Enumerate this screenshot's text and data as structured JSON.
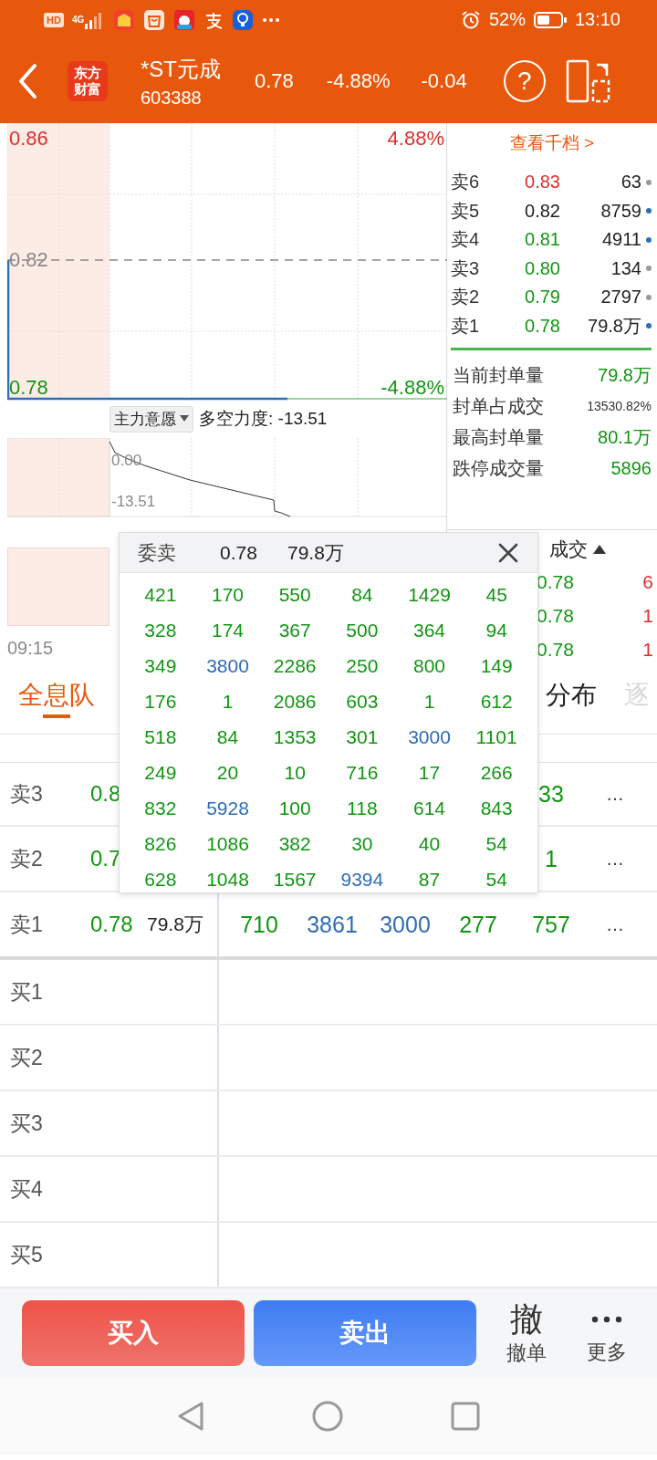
{
  "status_bar": {
    "hd": "HD",
    "network": "4G",
    "battery": "52%",
    "time": "13:10"
  },
  "header": {
    "logo_text": "东方财富",
    "name": "*ST元成",
    "code": "603388",
    "price": "0.78",
    "change_percent": "-4.88%",
    "change": "-0.04",
    "help": "?"
  },
  "price_chart": {
    "top_price": "0.86",
    "top_percent": "4.88%",
    "mid_price": "0.82",
    "bottom_price": "0.78",
    "bottom_percent": "-4.88%"
  },
  "indicator": {
    "selector": "主力意愿",
    "reading": "多空力度: -13.51",
    "top_label": "0.00",
    "bottom_label": "-13.51"
  },
  "time_axis": [
    "09:15"
  ],
  "order_book": {
    "link": "查看千档 >",
    "asks": [
      {
        "label": "卖6",
        "price": "0.83",
        "volume": "63",
        "color": "#d8302f",
        "large": false
      },
      {
        "label": "卖5",
        "price": "0.82",
        "volume": "8759",
        "color": "#222222",
        "large": true
      },
      {
        "label": "卖4",
        "price": "0.81",
        "volume": "4911",
        "color": "#129612",
        "large": true
      },
      {
        "label": "卖3",
        "price": "0.80",
        "volume": "134",
        "color": "#129612",
        "large": false
      },
      {
        "label": "卖2",
        "price": "0.79",
        "volume": "2797",
        "color": "#129612",
        "large": false
      },
      {
        "label": "卖1",
        "price": "0.78",
        "volume": "79.8万",
        "color": "#129612",
        "large": true
      }
    ]
  },
  "seal_stats": [
    {
      "label": "当前封单量",
      "value": "79.8万",
      "kind": "volume"
    },
    {
      "label": "封单占成交",
      "value": "13530.82%",
      "kind": "ratio"
    },
    {
      "label": "最高封单量",
      "value": "80.1万",
      "kind": "volume"
    },
    {
      "label": "跌停成交量",
      "value": "5896",
      "kind": "volume"
    }
  ],
  "trades": {
    "header": "成交",
    "rows": [
      {
        "price": "0.78",
        "volume": "6"
      },
      {
        "price": "0.78",
        "volume": "1"
      },
      {
        "price": "0.78",
        "volume": "1"
      }
    ]
  },
  "tabs": [
    {
      "label": "全息队",
      "selected": true,
      "disabled": false
    },
    {
      "label": "分布",
      "selected": false,
      "disabled": false
    },
    {
      "label": "逐",
      "selected": false,
      "disabled": true
    }
  ],
  "queue": {
    "asks": [
      {
        "label": "卖3",
        "price": "0.8",
        "cells": [
          {
            "text": "33",
            "large": false
          }
        ],
        "more": "…"
      },
      {
        "label": "卖2",
        "price": "0.7",
        "cells": [
          {
            "text": "1",
            "large": false
          }
        ],
        "more": "…"
      },
      {
        "label": "卖1",
        "price": "0.78",
        "volume": "79.8万",
        "cells": [
          {
            "text": "710",
            "large": false
          },
          {
            "text": "3861",
            "large": true
          },
          {
            "text": "3000",
            "large": true
          },
          {
            "text": "277",
            "large": false
          },
          {
            "text": "757",
            "large": false
          }
        ],
        "more": "…"
      }
    ],
    "bids": [
      {
        "label": "买1"
      },
      {
        "label": "买2"
      },
      {
        "label": "买3"
      },
      {
        "label": "买4"
      },
      {
        "label": "买5"
      }
    ]
  },
  "popup": {
    "title": "委卖",
    "price": "0.78",
    "volume": "79.8万",
    "rows": [
      [
        {
          "text": "421",
          "large": false
        },
        {
          "text": "170",
          "large": false
        },
        {
          "text": "550",
          "large": false
        },
        {
          "text": "84",
          "large": false
        },
        {
          "text": "1429",
          "large": false
        },
        {
          "text": "45",
          "large": false
        }
      ],
      [
        {
          "text": "328",
          "large": false
        },
        {
          "text": "174",
          "large": false
        },
        {
          "text": "367",
          "large": false
        },
        {
          "text": "500",
          "large": false
        },
        {
          "text": "364",
          "large": false
        },
        {
          "text": "94",
          "large": false
        }
      ],
      [
        {
          "text": "349",
          "large": false
        },
        {
          "text": "3800",
          "large": true
        },
        {
          "text": "2286",
          "large": false
        },
        {
          "text": "250",
          "large": false
        },
        {
          "text": "800",
          "large": false
        },
        {
          "text": "149",
          "large": false
        }
      ],
      [
        {
          "text": "176",
          "large": false
        },
        {
          "text": "1",
          "large": false
        },
        {
          "text": "2086",
          "large": false
        },
        {
          "text": "603",
          "large": false
        },
        {
          "text": "1",
          "large": false
        },
        {
          "text": "612",
          "large": false
        }
      ],
      [
        {
          "text": "518",
          "large": false
        },
        {
          "text": "84",
          "large": false
        },
        {
          "text": "1353",
          "large": false
        },
        {
          "text": "301",
          "large": false
        },
        {
          "text": "3000",
          "large": true
        },
        {
          "text": "1101",
          "large": false
        }
      ],
      [
        {
          "text": "249",
          "large": false
        },
        {
          "text": "20",
          "large": false
        },
        {
          "text": "10",
          "large": false
        },
        {
          "text": "716",
          "large": false
        },
        {
          "text": "17",
          "large": false
        },
        {
          "text": "266",
          "large": false
        }
      ],
      [
        {
          "text": "832",
          "large": false
        },
        {
          "text": "5928",
          "large": true
        },
        {
          "text": "100",
          "large": false
        },
        {
          "text": "118",
          "large": false
        },
        {
          "text": "614",
          "large": false
        },
        {
          "text": "843",
          "large": false
        }
      ],
      [
        {
          "text": "826",
          "large": false
        },
        {
          "text": "1086",
          "large": false
        },
        {
          "text": "382",
          "large": false
        },
        {
          "text": "30",
          "large": false
        },
        {
          "text": "40",
          "large": false
        },
        {
          "text": "54",
          "large": false
        }
      ],
      [
        {
          "text": "628",
          "large": false
        },
        {
          "text": "1048",
          "large": false
        },
        {
          "text": "1567",
          "large": false
        },
        {
          "text": "9394",
          "large": true
        },
        {
          "text": "87",
          "large": false
        },
        {
          "text": "54",
          "large": false
        }
      ]
    ]
  },
  "actions": {
    "buy": "买入",
    "sell": "卖出",
    "cancel_glyph": "撤",
    "cancel": "撤单",
    "more": "更多"
  }
}
